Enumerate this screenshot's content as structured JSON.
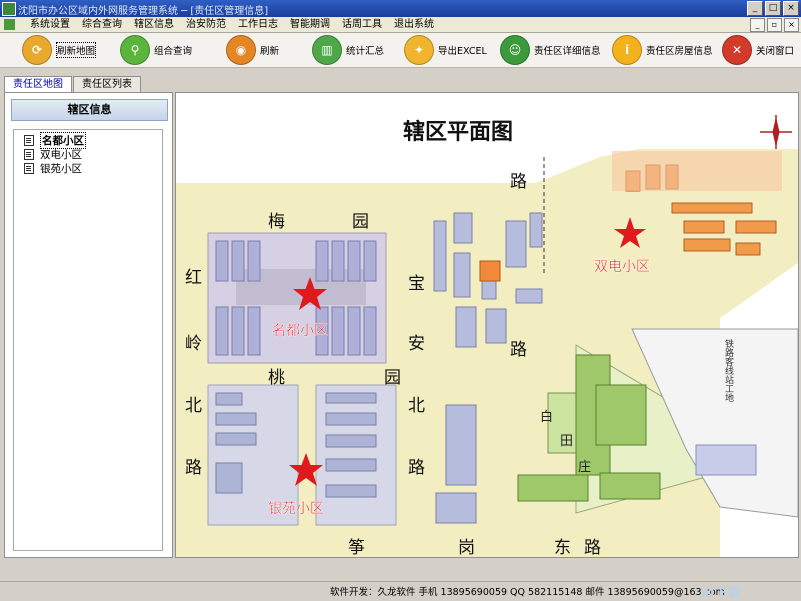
{
  "window": {
    "title": "沈阳市办公区域内外网服务管理系统 ─ [责任区管理信息]"
  },
  "menu": {
    "items": [
      "系统设置",
      "综合查询",
      "辖区信息",
      "治安防范",
      "工作日志",
      "智能期调",
      "话周工具",
      "退出系统"
    ]
  },
  "toolbar": {
    "buttons": [
      {
        "label": "刷新地图",
        "icon": "refresh-icon",
        "color": "#e8a92c"
      },
      {
        "label": "组合查询",
        "icon": "search-icon",
        "color": "#5bb53d"
      },
      {
        "label": "刷新",
        "icon": "rss-icon",
        "color": "#e48625"
      },
      {
        "label": "统计汇总",
        "icon": "chart-icon",
        "color": "#4ea84a"
      },
      {
        "label": "导出EXCEL",
        "icon": "export-star-icon",
        "color": "#f0b52c"
      },
      {
        "label": "责任区详细信息",
        "icon": "person-icon",
        "color": "#3c9a3c"
      },
      {
        "label": "责任区房屋信息",
        "icon": "info-icon",
        "color": "#f3b21b"
      },
      {
        "label": "关闭窗口",
        "icon": "close-icon",
        "color": "#d23a2a"
      }
    ]
  },
  "tabs": [
    "责任区地图",
    "责任区列表"
  ],
  "left_panel": {
    "header": "辖区信息",
    "items": [
      "名都小区",
      "双电小区",
      "银苑小区"
    ]
  },
  "map": {
    "title": "辖区平面图",
    "roads": {
      "mei": "梅",
      "yuan": "园",
      "hong": "红",
      "ling": "岭",
      "bei": "北",
      "lu": "路",
      "bao": "宝",
      "an": "安",
      "tao": "桃",
      "lu2": "路",
      "bei2": "北",
      "yuan2": "园",
      "lu3": "路",
      "lu4": "路",
      "zhu": "筝",
      "gang": "岗",
      "dong": "东",
      "lu5": "路",
      "bai": "白",
      "tian": "田",
      "zhuang": "庄"
    },
    "labels": {
      "mingdu": "名都小区",
      "shuangdian": "双电小区",
      "yinyuan": "银苑小区",
      "rail": "铁路客线站工地"
    }
  },
  "status": {
    "text": "软件开发：久龙软件  手机 13895690059  QQ 582115148  邮件 13895690059@163.com",
    "watermark": "Xi下载"
  }
}
